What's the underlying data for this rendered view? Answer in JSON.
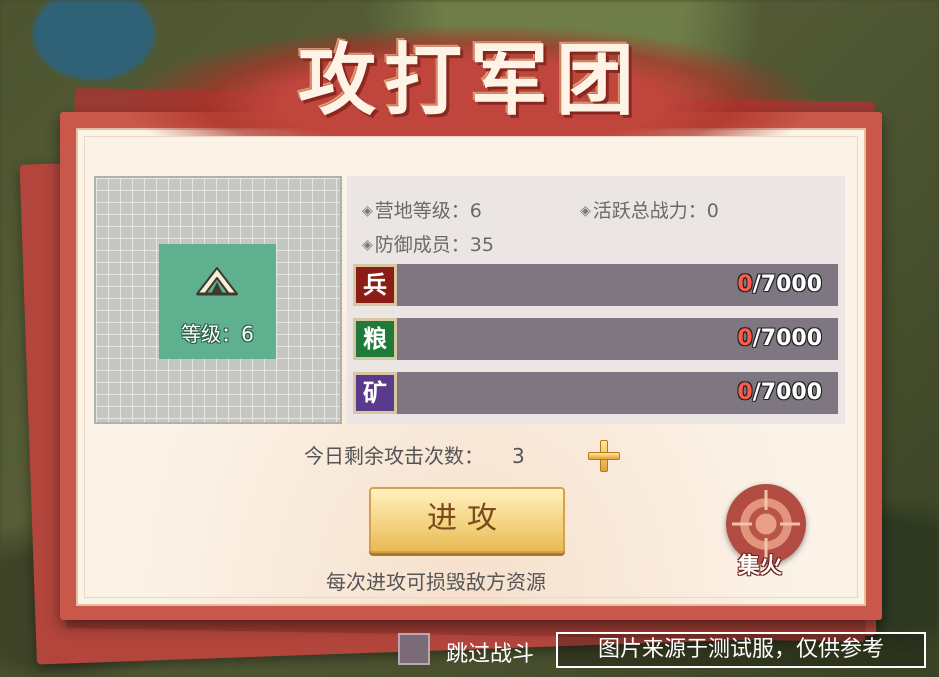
{
  "title": "攻打军团",
  "camp": {
    "level_label": "等级：6",
    "icon": "tent-icon",
    "color": "#5fb08f"
  },
  "stats": {
    "camp_level": "营地等级：6",
    "active_power": "活跃总战力：0",
    "defenders": "防御成员：35"
  },
  "resources": [
    {
      "icon_label": "兵",
      "icon": "soldier-icon",
      "current": "0",
      "max": "/7000",
      "color": "#8a1e16"
    },
    {
      "icon_label": "粮",
      "icon": "grain-icon",
      "current": "0",
      "max": "/7000",
      "color": "#1f7a3a"
    },
    {
      "icon_label": "矿",
      "icon": "ore-icon",
      "current": "0",
      "max": "/7000",
      "color": "#5a3a8a"
    }
  ],
  "remaining": {
    "label": "今日剩余攻击次数：",
    "count": "3"
  },
  "attack_button": "进攻",
  "hint": "每次进攻可损毁敌方资源",
  "focus_fire": "集火",
  "skip_battle": "跳过战斗",
  "watermark": "图片来源于测试服，仅供参考"
}
